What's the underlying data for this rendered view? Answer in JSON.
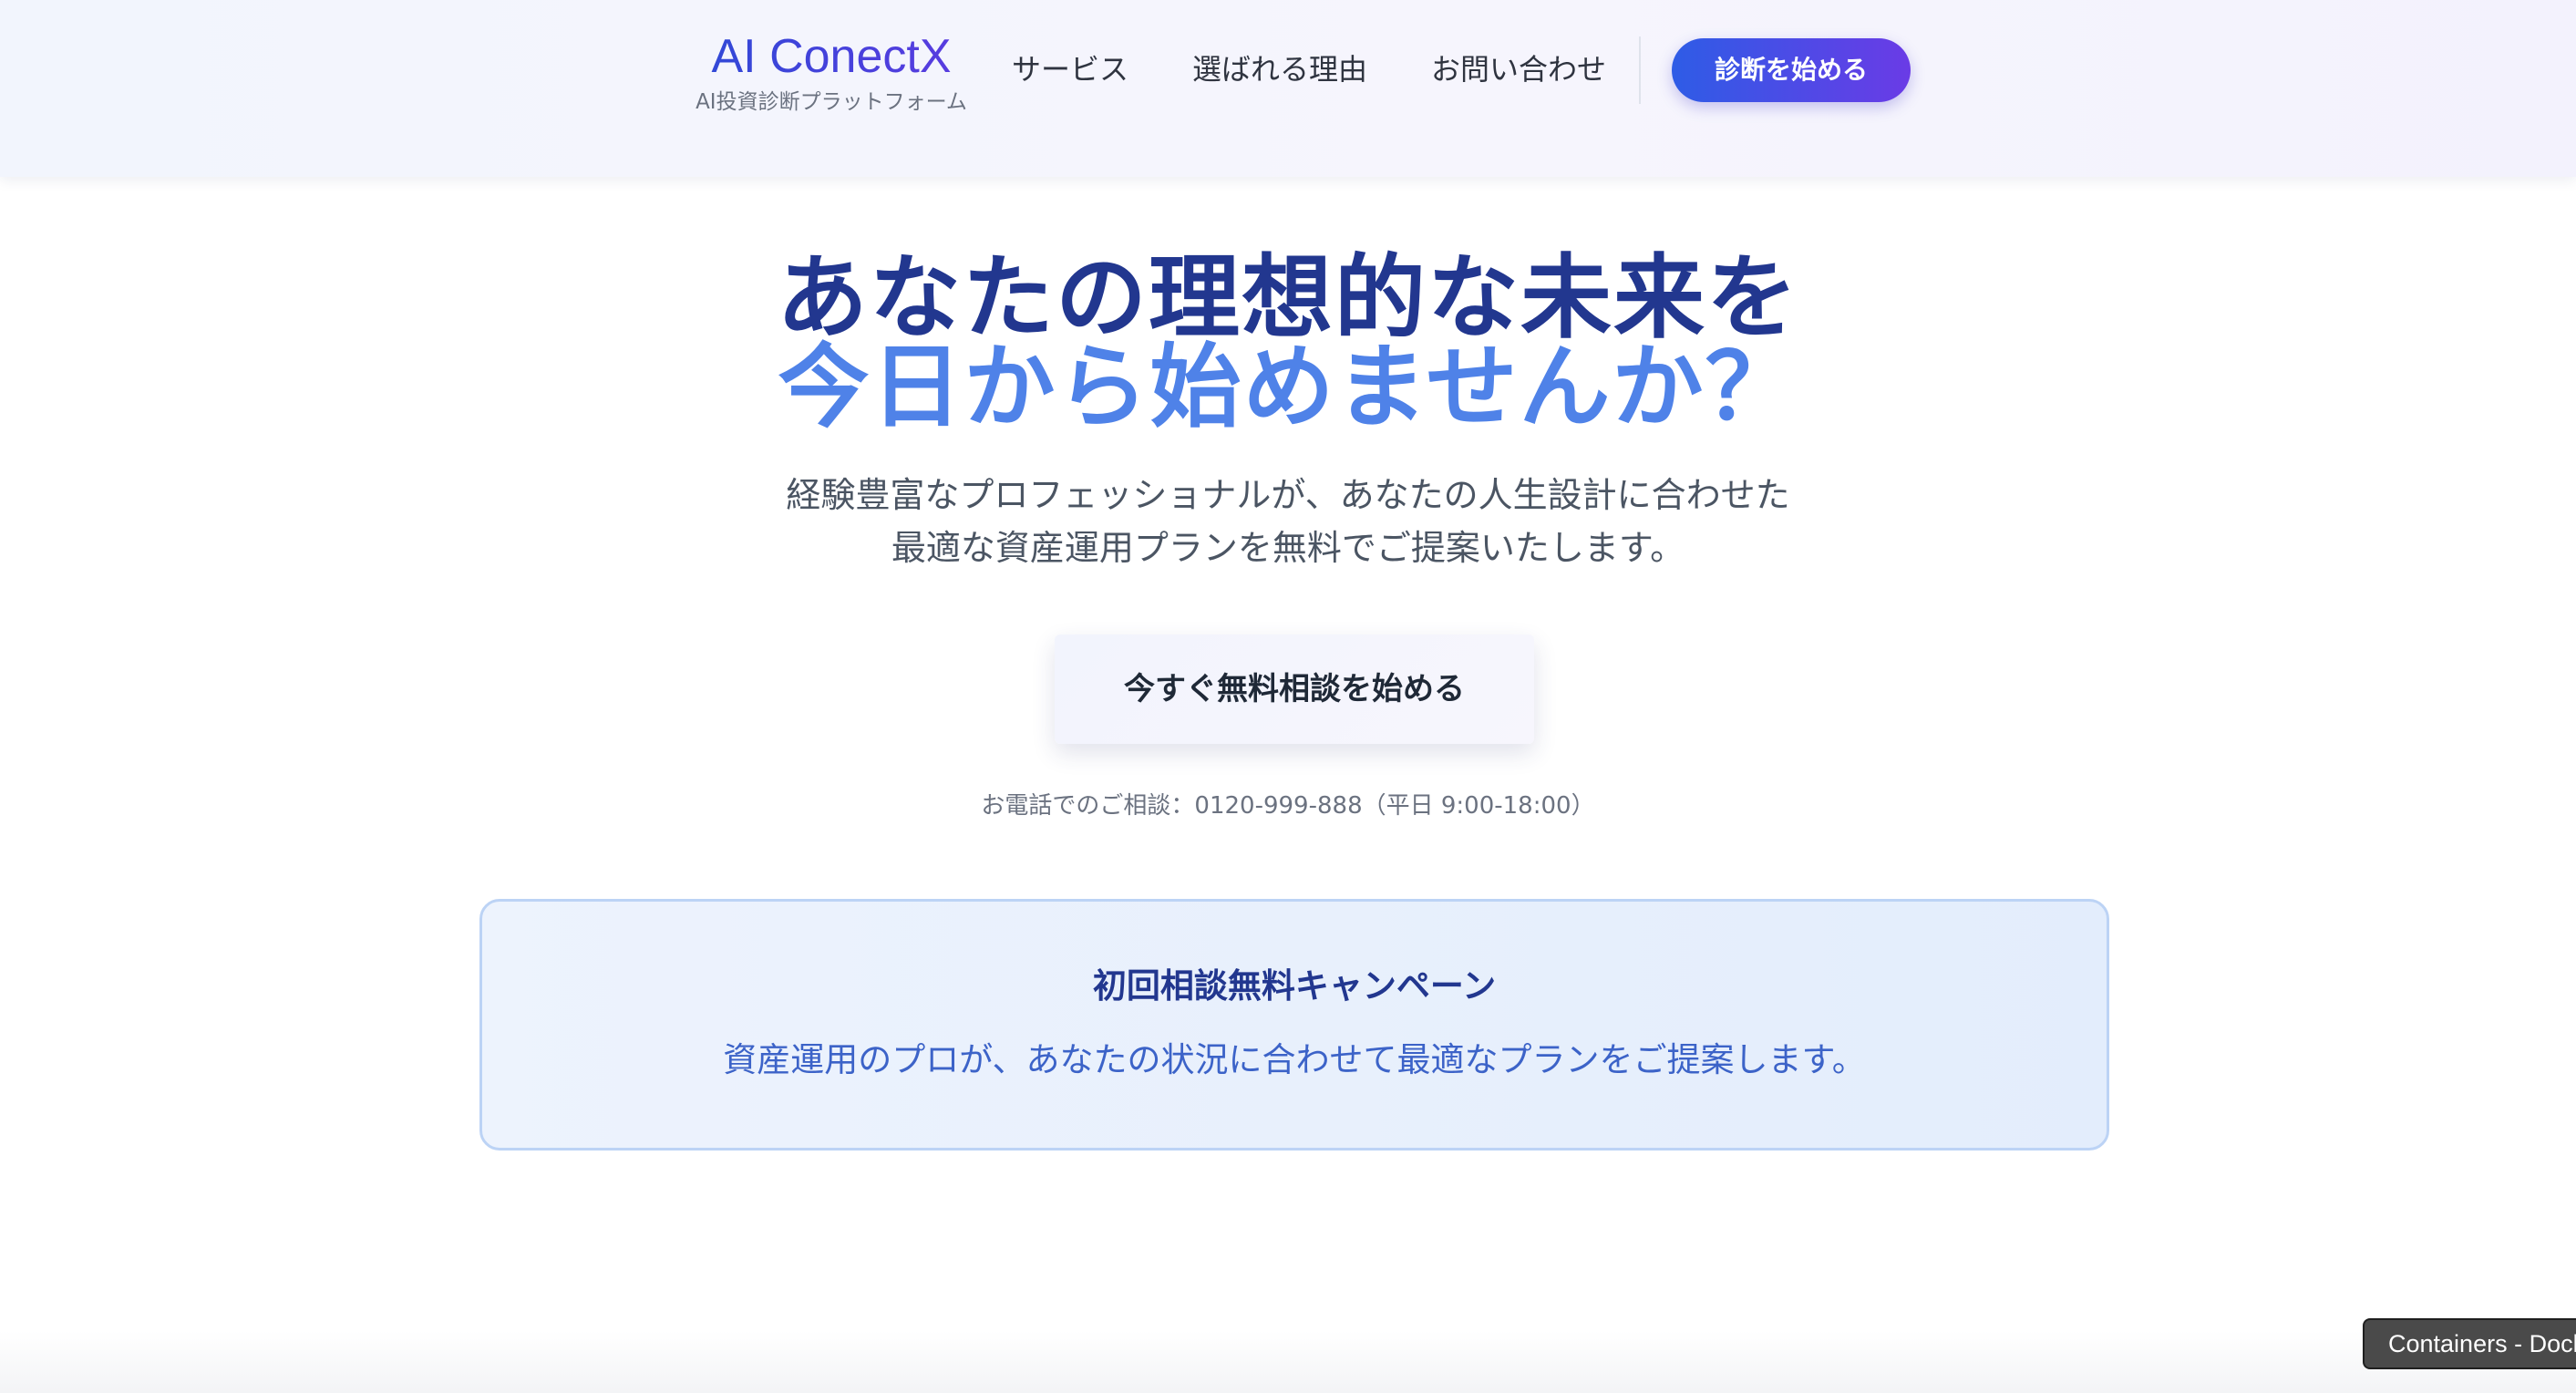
{
  "header": {
    "logo_title": "AI ConectX",
    "logo_subtitle": "AI投資診断プラットフォーム",
    "nav": {
      "service": "サービス",
      "reason": "選ばれる理由",
      "contact": "お問い合わせ"
    },
    "cta_label": "診断を始める"
  },
  "hero": {
    "headline_line1": "あなたの理想的な未来を",
    "headline_line2": "今日から始めませんか？",
    "description_line1": "経験豊富なプロフェッショナルが、あなたの人生設計に合わせた",
    "description_line2": "最適な資産運用プランを無料でご提案いたします。",
    "cta_label": "今すぐ無料相談を始める",
    "phone_note": "お電話でのご相談：0120-999-888（平日 9:00-18:00）"
  },
  "campaign": {
    "title": "初回相談無料キャンペーン",
    "text": "資産運用のプロが、あなたの状況に合わせて最適なプランをご提案します。"
  },
  "tooltip": {
    "text": "Containers - Docker"
  },
  "colors": {
    "brand_blue": "#2f49d6",
    "brand_purple": "#6a3be6",
    "headline_dark": "#22378f",
    "headline_light": "#4f82e8",
    "campaign_text": "#3c63c8"
  }
}
